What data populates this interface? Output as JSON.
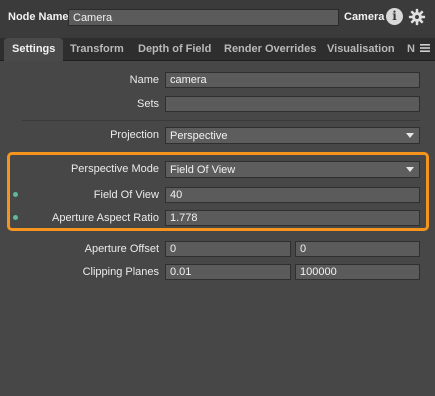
{
  "header": {
    "node_name_label": "Node Name",
    "node_name_value": "Camera",
    "node_type": "Camera",
    "info_icon": "info-icon",
    "gear_icon": "gear-icon"
  },
  "tabs": [
    {
      "label": "Settings",
      "active": true
    },
    {
      "label": "Transform",
      "active": false
    },
    {
      "label": "Depth of Field",
      "active": false
    },
    {
      "label": "Render Overrides",
      "active": false
    },
    {
      "label": "Visualisation",
      "active": false
    },
    {
      "label": "N",
      "active": false
    }
  ],
  "settings": {
    "name_label": "Name",
    "name_value": "camera",
    "sets_label": "Sets",
    "sets_value": "",
    "projection_label": "Projection",
    "projection_value": "Perspective",
    "perspective_mode_label": "Perspective Mode",
    "perspective_mode_value": "Field Of View",
    "field_of_view_label": "Field Of View",
    "field_of_view_value": "40",
    "aperture_aspect_label": "Aperture Aspect Ratio",
    "aperture_aspect_value": "1.778",
    "aperture_offset_label": "Aperture Offset",
    "aperture_offset_x": "0",
    "aperture_offset_y": "0",
    "clipping_planes_label": "Clipping Planes",
    "clipping_near": "0.01",
    "clipping_far": "100000"
  },
  "colors": {
    "highlight": "#f5951d",
    "indicator_dot": "#5fb7a0"
  }
}
